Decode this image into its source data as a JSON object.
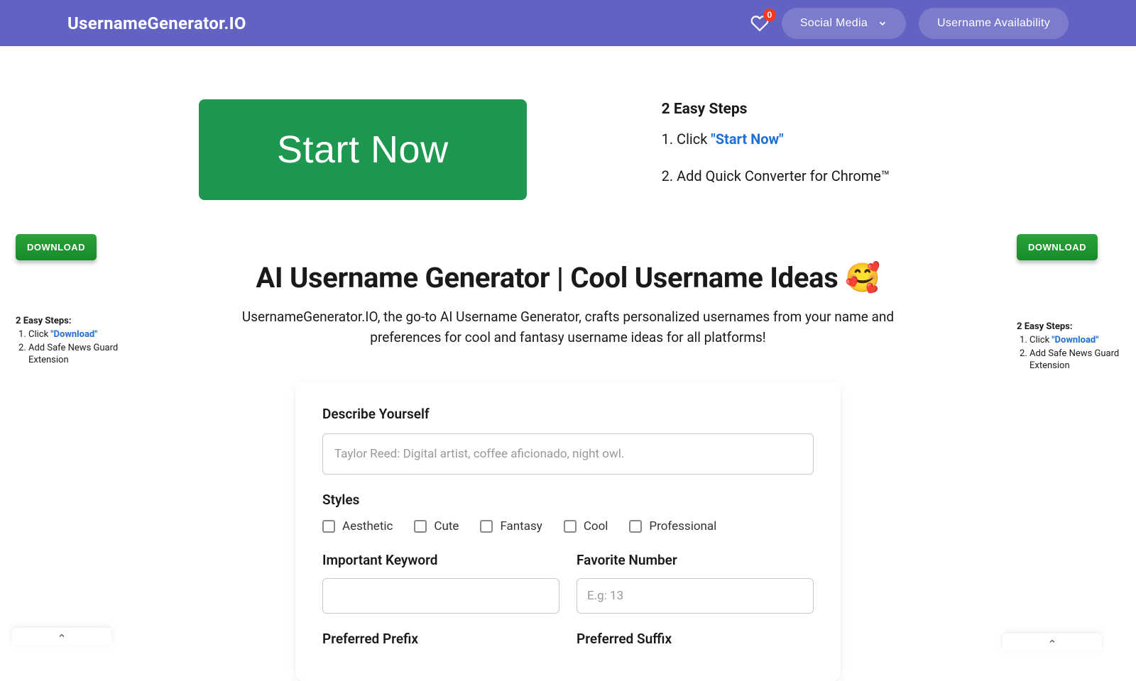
{
  "header": {
    "logo": "UsernameGenerator.IO",
    "badge_count": "0",
    "social_media_label": "Social Media",
    "availability_label": "Username Availability"
  },
  "promo": {
    "start_now": "Start Now",
    "steps_title": "2 Easy Steps",
    "step1_prefix": "1. Click ",
    "step1_link": "\"Start Now\"",
    "step2": "2. Add Quick Converter for Chrome™"
  },
  "main": {
    "title": "AI Username Generator | Cool Username Ideas 🥰",
    "subtitle": "UsernameGenerator.IO, the go-to AI Username Generator, crafts personalized usernames from your name and preferences for cool and fantasy username ideas for all platforms!"
  },
  "form": {
    "describe_label": "Describe Yourself",
    "describe_placeholder": "Taylor Reed: Digital artist, coffee aficionado, night owl.",
    "styles_label": "Styles",
    "styles": [
      "Aesthetic",
      "Cute",
      "Fantasy",
      "Cool",
      "Professional"
    ],
    "keyword_label": "Important Keyword",
    "favnum_label": "Favorite Number",
    "favnum_placeholder": "E.g: 13",
    "prefix_label": "Preferred Prefix",
    "suffix_label": "Preferred Suffix"
  },
  "side_ad": {
    "download": "DOWNLOAD",
    "title": "2 Easy Steps:",
    "li1_prefix": "Click ",
    "li1_link": "\"Download\"",
    "li2": "Add Safe News Guard Extension"
  }
}
